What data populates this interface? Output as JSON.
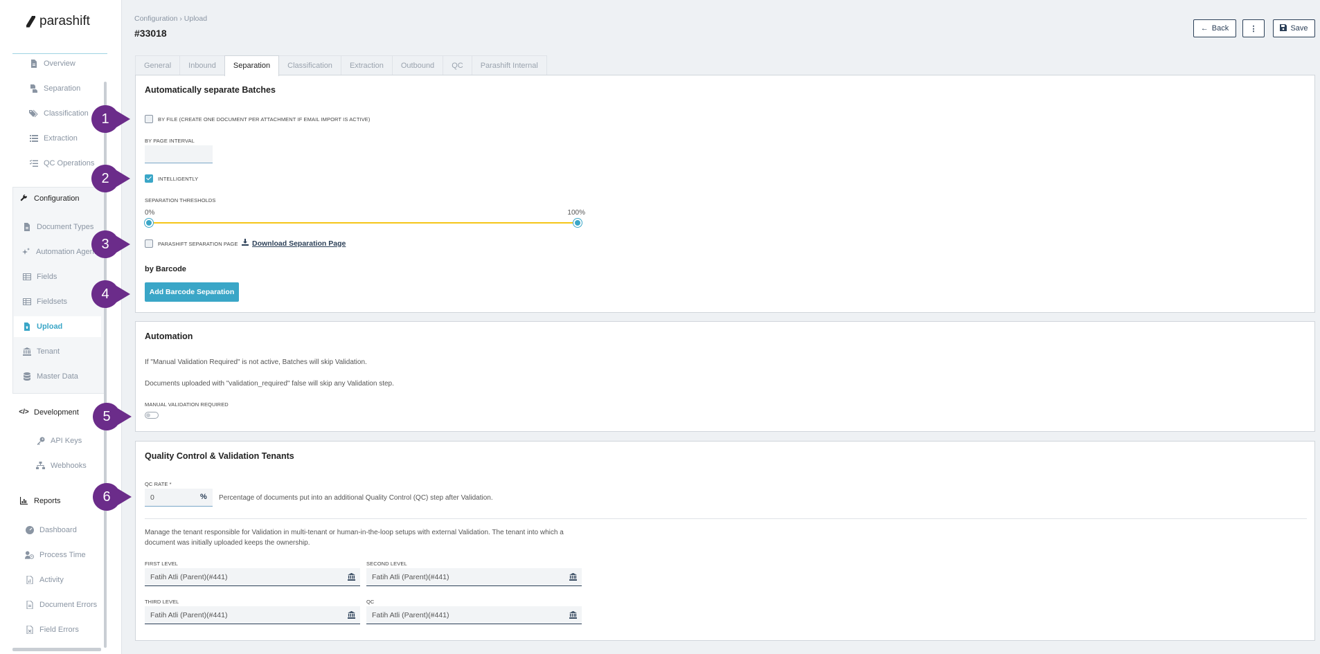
{
  "brand": {
    "name": "parashift"
  },
  "header": {
    "breadcrumb": "Configuration › Upload",
    "page_id": "#33018",
    "back_label": "Back",
    "more_label": "⋮",
    "save_label": "Save"
  },
  "sidebar": {
    "top_items": [
      {
        "label": "Overview",
        "icon": "document-icon"
      },
      {
        "label": "Separation",
        "icon": "separation-icon"
      },
      {
        "label": "Classification",
        "icon": "tags-icon"
      },
      {
        "label": "Extraction",
        "icon": "list-icon"
      },
      {
        "label": "QC Operations",
        "icon": "checklist-icon"
      }
    ],
    "configuration": {
      "label": "Configuration",
      "items": [
        {
          "label": "Document Types",
          "icon": "document-icon"
        },
        {
          "label": "Automation Agents",
          "icon": "sparkle-icon"
        },
        {
          "label": "Fields",
          "icon": "table-icon"
        },
        {
          "label": "Fieldsets",
          "icon": "table-icon"
        },
        {
          "label": "Upload",
          "icon": "upload-icon",
          "active": true
        },
        {
          "label": "Tenant",
          "icon": "bank-icon"
        },
        {
          "label": "Master Data",
          "icon": "database-icon"
        }
      ]
    },
    "development": {
      "label": "Development",
      "items": [
        {
          "label": "API Keys",
          "icon": "key-icon"
        },
        {
          "label": "Webhooks",
          "icon": "sitemap-icon"
        }
      ]
    },
    "reports": {
      "label": "Reports",
      "items": [
        {
          "label": "Dashboard",
          "icon": "gauge-icon"
        },
        {
          "label": "Process Time",
          "icon": "user-clock-icon"
        },
        {
          "label": "Activity",
          "icon": "file-chart-icon"
        },
        {
          "label": "Document Errors",
          "icon": "file-error-icon"
        },
        {
          "label": "Field Errors",
          "icon": "file-x-icon"
        }
      ]
    }
  },
  "tabs": [
    {
      "label": "General"
    },
    {
      "label": "Inbound"
    },
    {
      "label": "Separation",
      "active": true
    },
    {
      "label": "Classification"
    },
    {
      "label": "Extraction"
    },
    {
      "label": "Outbound"
    },
    {
      "label": "QC"
    },
    {
      "label": "Parashift Internal"
    }
  ],
  "separation": {
    "title": "Automatically separate Batches",
    "by_file_label": "BY FILE (CREATE ONE DOCUMENT PER ATTACHMENT IF EMAIL IMPORT IS ACTIVE)",
    "by_file_checked": false,
    "by_page_interval_label": "BY PAGE INTERVAL",
    "by_page_interval_value": "",
    "intelligently_label": "INTELLIGENTLY",
    "intelligently_checked": true,
    "thresholds_label": "SEPARATION THRESHOLDS",
    "threshold_min_label": "0%",
    "threshold_max_label": "100%",
    "threshold_min": 0,
    "threshold_max": 100,
    "parashift_page_label": "PARASHIFT SEPARATION PAGE",
    "parashift_page_checked": false,
    "download_label": "Download Separation Page",
    "barcode_heading": "by Barcode",
    "add_barcode_label": "Add Barcode Separation"
  },
  "automation": {
    "title": "Automation",
    "line1": "If \"Manual Validation Required\" is not active, Batches will skip Validation.",
    "line2": "Documents uploaded with \"validation_required\" false will skip any Validation step.",
    "manual_validation_label": "MANUAL VALIDATION REQUIRED",
    "manual_validation_on": false
  },
  "qc": {
    "title": "Quality Control & Validation Tenants",
    "qc_rate_label": "QC RATE *",
    "qc_rate_value": "0",
    "qc_rate_unit": "%",
    "qc_rate_help": "Percentage of documents put into an additional Quality Control (QC) step after Validation.",
    "tenant_help_1": "Manage the tenant responsible for Validation in multi-tenant or human-in-the-loop setups with external Validation. The tenant into which a",
    "tenant_help_2": "document was initially uploaded keeps the ownership.",
    "first_level_label": "FIRST LEVEL",
    "first_level_value": "Fatih Atli (Parent)(#441)",
    "second_level_label": "SECOND LEVEL",
    "second_level_value": "Fatih Atli (Parent)(#441)",
    "third_level_label": "THIRD LEVEL",
    "third_level_value": "Fatih Atli (Parent)(#441)",
    "qc_level_label": "QC",
    "qc_level_value": "Fatih Atli (Parent)(#441)"
  },
  "markers": [
    "1",
    "2",
    "3",
    "4",
    "5",
    "6"
  ],
  "colors": {
    "accent": "#3aa6c7",
    "marker": "#6b2c8a",
    "slider": "#f5c518",
    "dark": "#2b3f57"
  }
}
